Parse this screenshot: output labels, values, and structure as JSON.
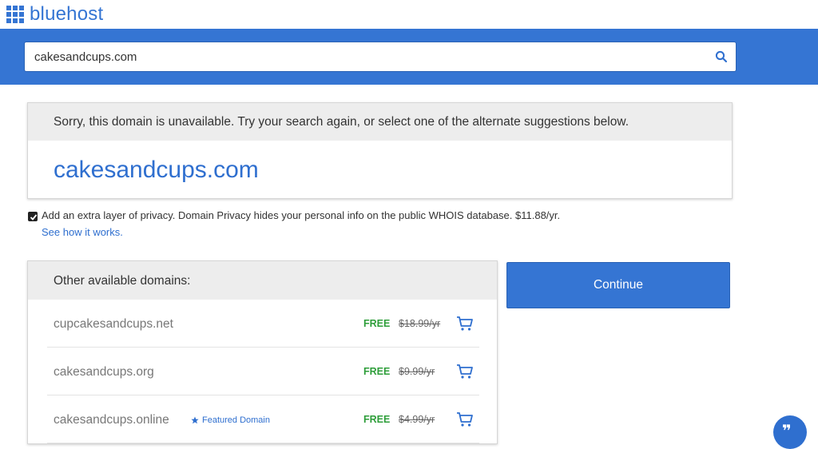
{
  "header": {
    "brand": "bluehost"
  },
  "search": {
    "value": "cakesandcups.com",
    "icon": "search-icon"
  },
  "result": {
    "message": "Sorry, this domain is unavailable. Try your search again, or select one of the alternate suggestions below.",
    "domain": "cakesandcups.com"
  },
  "privacy": {
    "checked": true,
    "text": "Add an extra layer of privacy. Domain Privacy hides your personal info on the public WHOIS database. $11.88/yr.",
    "link": "See how it works."
  },
  "other": {
    "title": "Other available domains:",
    "domains": [
      {
        "name": "cupcakesandcups.net",
        "featured": "",
        "price": "FREE",
        "old_price": "$18.99/yr"
      },
      {
        "name": "cakesandcups.org",
        "featured": "",
        "price": "FREE",
        "old_price": "$9.99/yr"
      },
      {
        "name": "cakesandcups.online",
        "featured": "Featured Domain",
        "price": "FREE",
        "old_price": "$4.99/yr"
      }
    ]
  },
  "actions": {
    "continue_label": "Continue"
  },
  "chat": {
    "glyph": "❞",
    "icon": "chat-icon"
  },
  "colors": {
    "brand_blue": "#3575d3",
    "link_blue": "#2f6fcf",
    "free_green": "#2e9e3a"
  }
}
